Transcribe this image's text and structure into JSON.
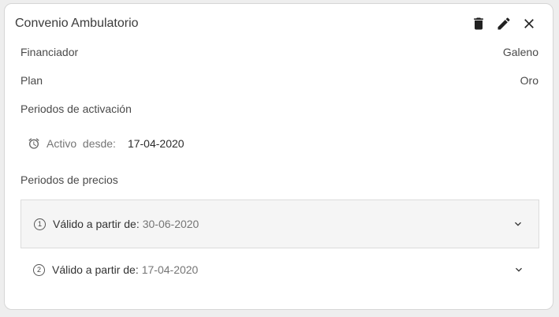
{
  "header": {
    "title": "Convenio Ambulatorio",
    "actions": {
      "delete_icon": "trash-icon",
      "edit_icon": "pencil-icon",
      "close_icon": "close-icon"
    }
  },
  "details": {
    "financiador_label": "Financiador",
    "financiador_value": "Galeno",
    "plan_label": "Plan",
    "plan_value": "Oro"
  },
  "activation": {
    "section_label": "Periodos de activación",
    "icon": "alarm-icon",
    "active_label": "Activo  desde:",
    "active_value": "17-04-2020"
  },
  "prices": {
    "section_label": "Periodos de precios",
    "items": [
      {
        "number": "1",
        "label": "Válido a partir de:",
        "date": "30-06-2020"
      },
      {
        "number": "2",
        "label": "Válido a partir de:",
        "date": "17-04-2020"
      }
    ]
  }
}
